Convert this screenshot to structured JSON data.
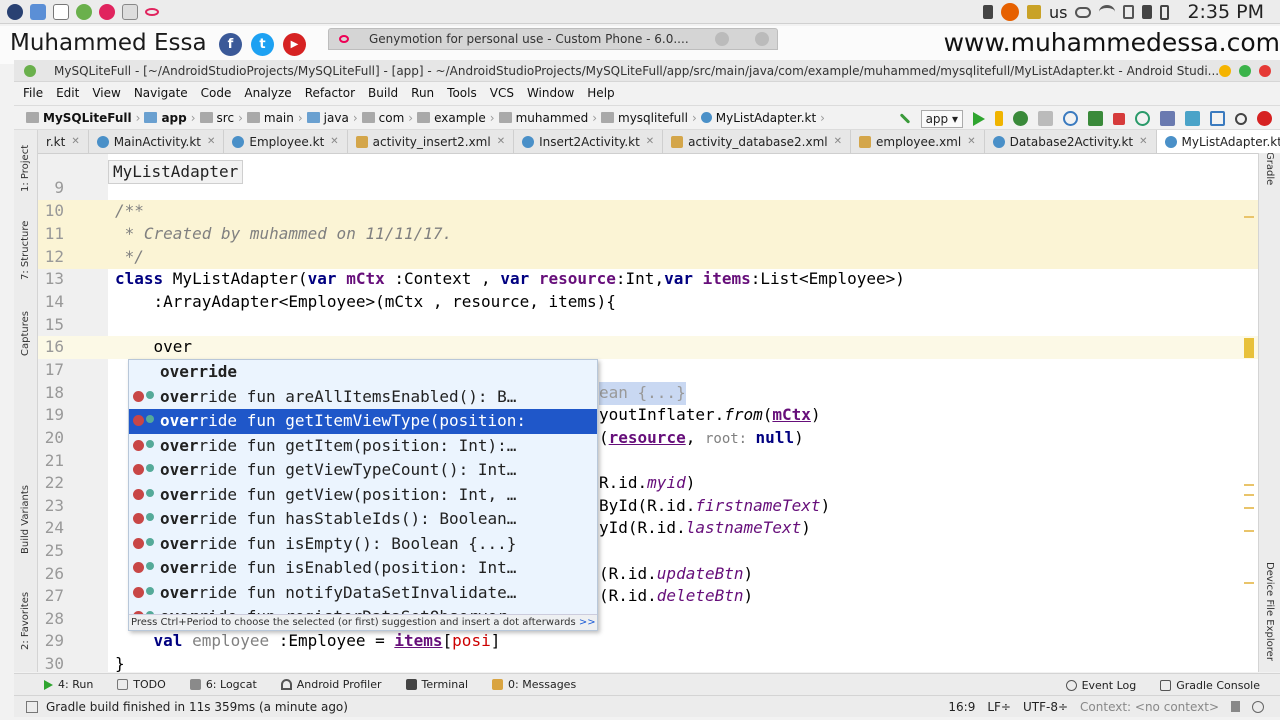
{
  "system_bar": {
    "clock": "2:35 PM",
    "keyboard_layout": "us"
  },
  "banner": {
    "name": "Muhammed Essa",
    "url": "www.muhammedessa.com",
    "social": [
      "f",
      "t",
      "▶"
    ]
  },
  "genymotion_tab": {
    "title": "Genymotion for personal use - Custom Phone - 6.0...."
  },
  "window": {
    "title": "MySQLiteFull - [~/AndroidStudioProjects/MySQLiteFull] - [app] - ~/AndroidStudioProjects/MySQLiteFull/app/src/main/java/com/example/muhammed/mysqlitefull/MyListAdapter.kt - Android Studi..."
  },
  "menu": [
    "File",
    "Edit",
    "View",
    "Navigate",
    "Code",
    "Analyze",
    "Refactor",
    "Build",
    "Run",
    "Tools",
    "VCS",
    "Window",
    "Help"
  ],
  "breadcrumb": [
    "MySQLiteFull",
    "app",
    "src",
    "main",
    "java",
    "com",
    "example",
    "muhammed",
    "mysqlitefull",
    "MyListAdapter.kt"
  ],
  "run_config": "app",
  "tabs": [
    {
      "label": "r.kt",
      "color": "#4a90c8"
    },
    {
      "label": "MainActivity.kt",
      "color": "#4a90c8"
    },
    {
      "label": "Employee.kt",
      "color": "#4a90c8"
    },
    {
      "label": "activity_insert2.xml",
      "color": "#d4a64a"
    },
    {
      "label": "Insert2Activity.kt",
      "color": "#4a90c8"
    },
    {
      "label": "activity_database2.xml",
      "color": "#d4a64a"
    },
    {
      "label": "employee.xml",
      "color": "#d4a64a"
    },
    {
      "label": "Database2Activity.kt",
      "color": "#4a90c8"
    },
    {
      "label": "MyListAdapter.kt",
      "color": "#4a90c8"
    }
  ],
  "tab_overflow": "≡2",
  "editor": {
    "class_popup": "MyListAdapter",
    "line_numbers": [
      "9",
      "10",
      "11",
      "12",
      "13",
      "14",
      "15",
      "16",
      "17",
      "18",
      "19",
      "20",
      "21",
      "22",
      "23",
      "24",
      "25",
      "26",
      "27",
      "28",
      "29",
      "30"
    ],
    "comment_open": "/**",
    "comment_body": " * Created by muhammed on 11/11/17.",
    "comment_close": " */",
    "l13_class": "class ",
    "l13_name": "MyListAdapter(",
    "l13_var1": "var ",
    "l13_p1": "mCtx",
    "l13_t1": " :Context , ",
    "l13_var2": "var ",
    "l13_p2": "resource",
    "l13_t2": ":Int,",
    "l13_var3": "var ",
    "l13_p3": "items",
    "l13_t3": ":List<Employee>)",
    "l14": "    :ArrayAdapter<Employee>(mCtx , resource, items){",
    "l16": "    over",
    "l18_tail": "ean {...}",
    "l19_tail_a": "youtInflater.",
    "l19_tail_b": "from",
    "l19_tail_c": "(",
    "l19_tail_d": "mCtx",
    "l19_tail_e": ")",
    "l20_a": "(",
    "l20_b": "resource",
    "l20_c": ", ",
    "l20_hint": "root: ",
    "l20_d": "null",
    "l20_e": ")",
    "l22_a": "R.id.",
    "l22_b": "myid",
    "l22_c": ")",
    "l23_a": "ById(R.id.",
    "l23_b": "firstnameText",
    "l23_c": ")",
    "l24_a": "yId(R.id.",
    "l24_b": "lastnameText",
    "l24_c": ")",
    "l26_a": "(R.id.",
    "l26_b": "updateBtn",
    "l26_c": ")",
    "l27_a": "(R.id.",
    "l27_b": "deleteBtn",
    "l27_c": ")",
    "l29_val": "    val ",
    "l29_emp": "employee",
    "l29_mid": " :Employee = ",
    "l29_items": "items",
    "l29_br": "[",
    "l29_posi": "posi",
    "l29_end": "]",
    "l30": "}"
  },
  "completion": {
    "items": [
      {
        "match": "over",
        "rest": "ride"
      },
      {
        "match": "over",
        "rest": "ride fun areAllItemsEnabled(): B…"
      },
      {
        "match": "over",
        "rest": "ride fun getItemViewType(position:"
      },
      {
        "match": "over",
        "rest": "ride fun getItem(position: Int):…"
      },
      {
        "match": "over",
        "rest": "ride fun getViewTypeCount(): Int…"
      },
      {
        "match": "over",
        "rest": "ride fun getView(position: Int, …"
      },
      {
        "match": "over",
        "rest": "ride fun hasStableIds(): Boolean…"
      },
      {
        "match": "over",
        "rest": "ride fun isEmpty(): Boolean {...}"
      },
      {
        "match": "over",
        "rest": "ride fun isEnabled(position: Int…"
      },
      {
        "match": "over",
        "rest": "ride fun notifyDataSetInvalidate…"
      },
      {
        "match": "over",
        "rest": "ride fun registerDataSetObserver…"
      }
    ],
    "selected_index": 2,
    "hint": "Press Ctrl+Period to choose the selected (or first) suggestion and insert a dot afterwards",
    "hint_link": ">>",
    "hint_pi": "π"
  },
  "left_tools": [
    "1: Project",
    "7: Structure",
    "Captures",
    "Build Variants",
    "2: Favorites"
  ],
  "right_tools": [
    "Gradle",
    "Device File Explorer"
  ],
  "bottom_tools": [
    {
      "label": "4: Run"
    },
    {
      "label": "TODO"
    },
    {
      "label": "6: Logcat"
    },
    {
      "label": "Android Profiler"
    },
    {
      "label": "Terminal"
    },
    {
      "label": "0: Messages"
    }
  ],
  "bottom_right_tools": [
    "Event Log",
    "Gradle Console"
  ],
  "status": {
    "message": "Gradle build finished in 11s 359ms (a minute ago)",
    "position": "16:9",
    "line_sep": "LF÷",
    "encoding": "UTF-8÷",
    "context": "Context: <no context>"
  }
}
